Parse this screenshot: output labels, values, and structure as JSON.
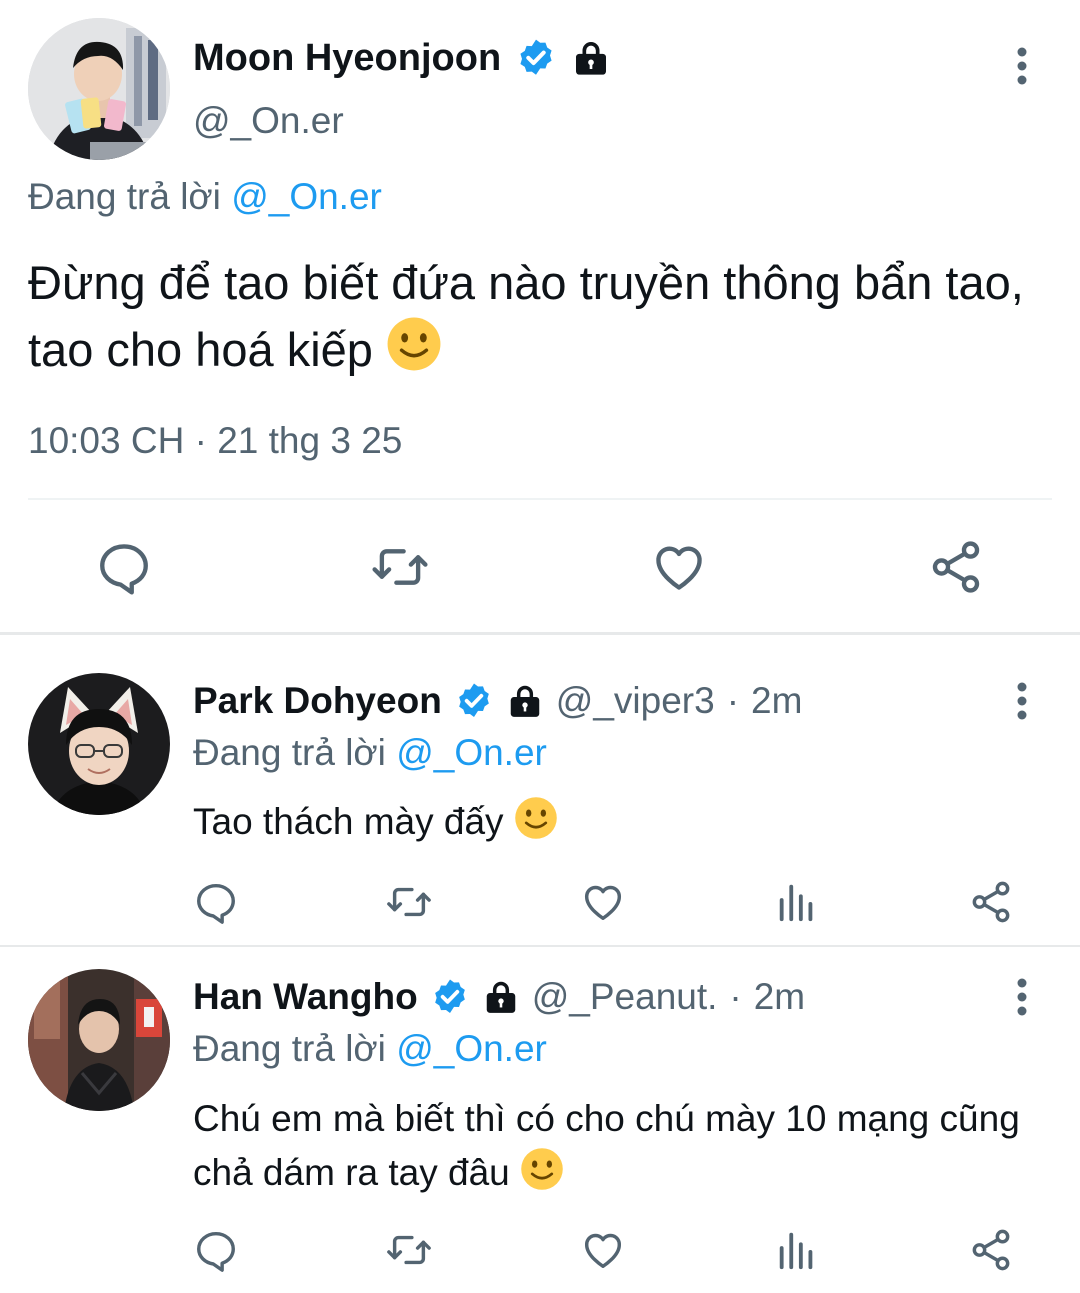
{
  "main_tweet": {
    "author_name": "Moon Hyeonjoon",
    "handle": "@_On.er",
    "replying_prefix": "Đang trả lời",
    "replying_to": "@_On.er",
    "text": "Đừng để tao biết đứa nào truyền thông bẩn tao, tao cho hoá kiếp",
    "time": "10:03 CH",
    "separator": "·",
    "date": "21 thg 3 25",
    "icons": [
      "verified-badge-icon",
      "lock-icon",
      "more-vertical-icon",
      "reply-icon",
      "retweet-icon",
      "like-icon",
      "share-icon",
      "slightly-smiling-face-emoji"
    ]
  },
  "replies": [
    {
      "author_name": "Park Dohyeon",
      "handle": "@_viper3",
      "separator": "·",
      "time": "2m",
      "replying_prefix": "Đang trả lời",
      "replying_to": "@_On.er",
      "text": "Tao thách mày đấy"
    },
    {
      "author_name": "Han Wangho",
      "handle": "@_Peanut.",
      "separator": "·",
      "time": "2m",
      "replying_prefix": "Đang trả lời",
      "replying_to": "@_On.er",
      "text": "Chú em mà biết thì có cho chú mày 10 mạng cũng chả dám ra tay đâu"
    }
  ],
  "reply_action_icons": [
    "reply-icon",
    "retweet-icon",
    "like-icon",
    "views-icon",
    "share-icon"
  ],
  "colors": {
    "accent": "#1d9bf0",
    "text": "#0f1419",
    "secondary_text": "#536471",
    "icon": "#536471",
    "divider": "#eff3f4",
    "emoji": "#ffcc4d"
  }
}
